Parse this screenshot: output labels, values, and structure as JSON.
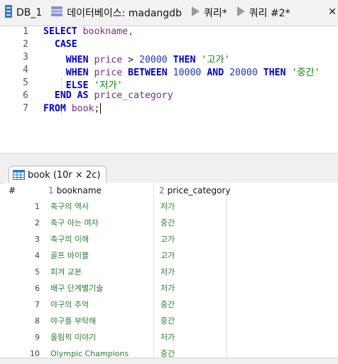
{
  "tabs": [
    {
      "label": "DB_1",
      "icon": "database-icon"
    },
    {
      "label": "데이터베이스: madangdb",
      "icon": "schema-icon"
    },
    {
      "label": "쿼리*",
      "icon": "play-icon"
    },
    {
      "label": "쿼리 #2*",
      "icon": "play-icon"
    }
  ],
  "close_glyph": "✕",
  "editor": {
    "line_numbers": [
      "1",
      "2",
      "3",
      "4",
      "5",
      "6",
      "7"
    ],
    "lines": [
      [
        {
          "t": "SELECT",
          "c": "kw"
        },
        {
          "t": " "
        },
        {
          "t": "bookname,",
          "c": "id"
        }
      ],
      [
        {
          "t": "  "
        },
        {
          "t": "CASE",
          "c": "kw"
        }
      ],
      [
        {
          "t": "    "
        },
        {
          "t": "WHEN",
          "c": "kw"
        },
        {
          "t": " "
        },
        {
          "t": "price",
          "c": "id"
        },
        {
          "t": " > "
        },
        {
          "t": "20000",
          "c": "num"
        },
        {
          "t": " "
        },
        {
          "t": "THEN",
          "c": "kw"
        },
        {
          "t": " "
        },
        {
          "t": "'고가'",
          "c": "str"
        }
      ],
      [
        {
          "t": "    "
        },
        {
          "t": "WHEN",
          "c": "kw"
        },
        {
          "t": " "
        },
        {
          "t": "price",
          "c": "id"
        },
        {
          "t": " "
        },
        {
          "t": "BETWEEN",
          "c": "kw"
        },
        {
          "t": " "
        },
        {
          "t": "10000",
          "c": "num"
        },
        {
          "t": " "
        },
        {
          "t": "AND",
          "c": "kw"
        },
        {
          "t": " "
        },
        {
          "t": "20000",
          "c": "num"
        },
        {
          "t": " "
        },
        {
          "t": "THEN",
          "c": "kw"
        },
        {
          "t": " "
        },
        {
          "t": "'중간'",
          "c": "str"
        }
      ],
      [
        {
          "t": "    "
        },
        {
          "t": "ELSE",
          "c": "kw"
        },
        {
          "t": " "
        },
        {
          "t": "'저가'",
          "c": "str"
        }
      ],
      [
        {
          "t": "  "
        },
        {
          "t": "END",
          "c": "kw"
        },
        {
          "t": " "
        },
        {
          "t": "AS",
          "c": "kw"
        },
        {
          "t": " "
        },
        {
          "t": "price_category",
          "c": "id"
        }
      ],
      [
        {
          "t": "FROM",
          "c": "kw"
        },
        {
          "t": " "
        },
        {
          "t": "book",
          "c": "id"
        },
        {
          "t": ";"
        }
      ]
    ]
  },
  "results_tab": {
    "label": "book (10r × 2c)",
    "icon": "table-grid-icon"
  },
  "grid": {
    "row_header": "#",
    "columns": [
      {
        "index": "1",
        "name": "bookname"
      },
      {
        "index": "2",
        "name": "price_category"
      }
    ],
    "rows": [
      {
        "n": "1",
        "bookname": "축구의 역사",
        "price_category": "저가"
      },
      {
        "n": "2",
        "bookname": "축구 아는 여자",
        "price_category": "중간"
      },
      {
        "n": "3",
        "bookname": "축구의 이해",
        "price_category": "고가"
      },
      {
        "n": "4",
        "bookname": "골프 바이블",
        "price_category": "고가"
      },
      {
        "n": "5",
        "bookname": "피겨 교본",
        "price_category": "저가"
      },
      {
        "n": "6",
        "bookname": "배구 단계별기술",
        "price_category": "저가"
      },
      {
        "n": "7",
        "bookname": "야구의 추억",
        "price_category": "중간"
      },
      {
        "n": "8",
        "bookname": "야구를 부탁해",
        "price_category": "중간"
      },
      {
        "n": "9",
        "bookname": "올림픽 이야기",
        "price_category": "저가"
      },
      {
        "n": "10",
        "bookname": "Olympic Champions",
        "price_category": "중간"
      }
    ]
  },
  "colors": {
    "keyword": "#0000c8",
    "identifier": "#7b2d7b",
    "number": "#1f35c8",
    "string": "#008800",
    "cell_text": "#2e7d32"
  }
}
